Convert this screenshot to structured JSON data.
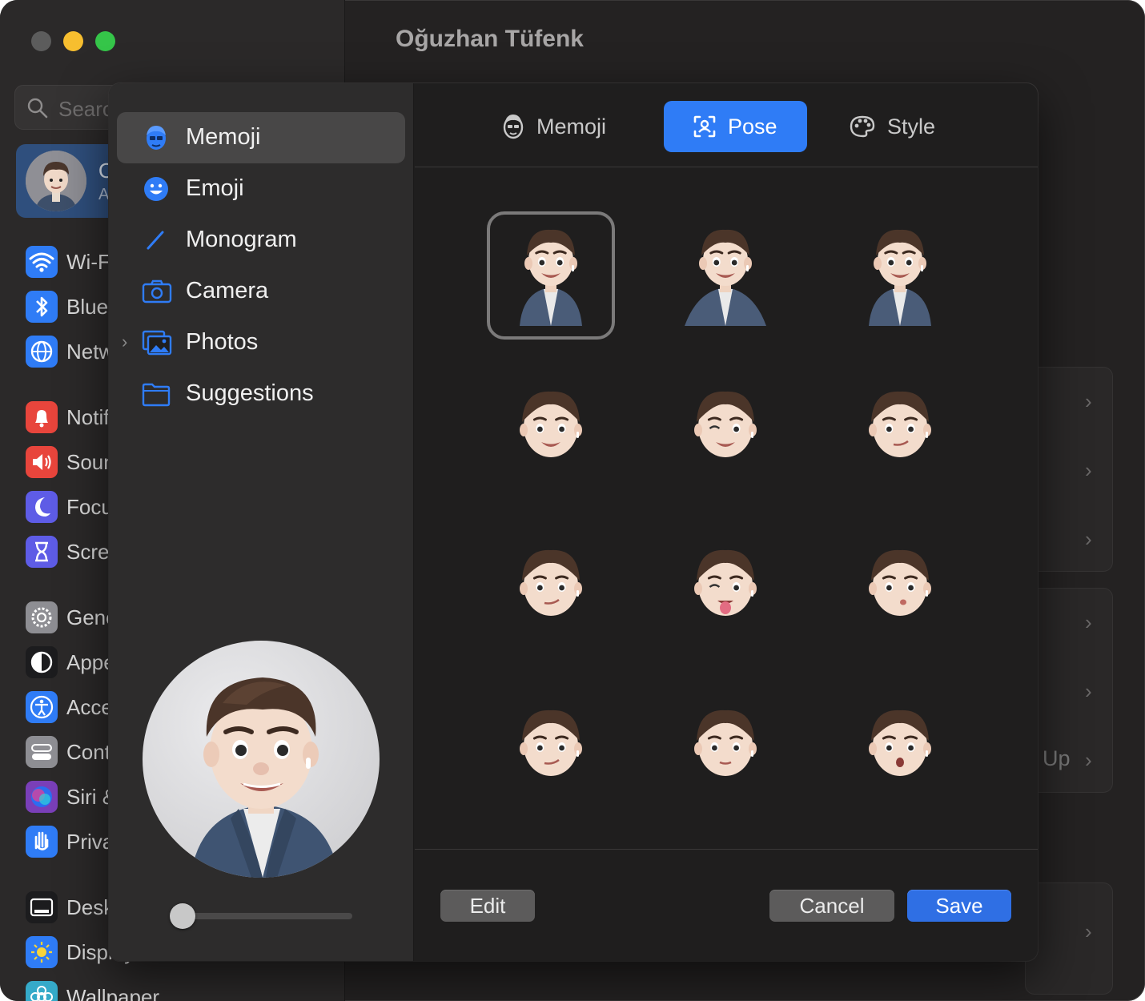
{
  "window": {
    "title": "Oğuzhan Tüfenk"
  },
  "sidebar": {
    "search_placeholder": "Search",
    "account": {
      "name": "O",
      "subtitle": "A"
    },
    "items": [
      {
        "label": "Wi-Fi",
        "icon": "wifi-icon",
        "color": "#2f7cf6"
      },
      {
        "label": "Bluetooth",
        "icon": "bluetooth-icon",
        "color": "#2f7cf6"
      },
      {
        "label": "Network",
        "icon": "globe-icon",
        "color": "#2f7cf6"
      },
      {
        "label": "Notifications",
        "icon": "bell-icon",
        "color": "#e8453c"
      },
      {
        "label": "Sound",
        "icon": "speaker-icon",
        "color": "#e8453c"
      },
      {
        "label": "Focus",
        "icon": "moon-icon",
        "color": "#5e5ce6"
      },
      {
        "label": "Screen Time",
        "icon": "hourglass-icon",
        "color": "#5e5ce6"
      },
      {
        "label": "General",
        "icon": "gear-icon",
        "color": "#8e8e93"
      },
      {
        "label": "Appearance",
        "icon": "appearance-icon",
        "color": "#1c1c1e"
      },
      {
        "label": "Accessibility",
        "icon": "accessibility-icon",
        "color": "#2f7cf6"
      },
      {
        "label": "Control Center",
        "icon": "toggles-icon",
        "color": "#8e8e93"
      },
      {
        "label": "Siri & Spotlight",
        "icon": "siri-icon",
        "color": "#7a3fb8"
      },
      {
        "label": "Privacy & Security",
        "icon": "hand-icon",
        "color": "#2f7cf6"
      },
      {
        "label": "Desktop & Dock",
        "icon": "dock-icon",
        "color": "#1c1c1e"
      },
      {
        "label": "Displays",
        "icon": "sun-icon",
        "color": "#2f7cf6"
      },
      {
        "label": "Wallpaper",
        "icon": "flower-icon",
        "color": "#35aac9"
      }
    ]
  },
  "background": {
    "up_label": "Up"
  },
  "dialog": {
    "sources": [
      {
        "label": "Memoji",
        "icon": "memoji-icon",
        "selected": true
      },
      {
        "label": "Emoji",
        "icon": "smiley-icon",
        "selected": false
      },
      {
        "label": "Monogram",
        "icon": "pencil-icon",
        "selected": false
      },
      {
        "label": "Camera",
        "icon": "camera-icon",
        "selected": false
      },
      {
        "label": "Photos",
        "icon": "photos-icon",
        "selected": false
      },
      {
        "label": "Suggestions",
        "icon": "folder-icon",
        "selected": false
      }
    ],
    "tabs": [
      {
        "label": "Memoji",
        "icon": "memoji-face-icon",
        "active": false
      },
      {
        "label": "Pose",
        "icon": "pose-icon",
        "active": true
      },
      {
        "label": "Style",
        "icon": "palette-icon",
        "active": false
      }
    ],
    "poses": [
      {
        "kind": "bust",
        "expression": "smile",
        "selected": true
      },
      {
        "kind": "bust",
        "expression": "arms-out",
        "selected": false
      },
      {
        "kind": "bust",
        "expression": "grin",
        "selected": false
      },
      {
        "kind": "head",
        "expression": "smile",
        "selected": false
      },
      {
        "kind": "head",
        "expression": "wink-smile",
        "selected": false
      },
      {
        "kind": "head",
        "expression": "smirk",
        "selected": false
      },
      {
        "kind": "head",
        "expression": "side-smirk",
        "selected": false
      },
      {
        "kind": "head",
        "expression": "wink-tongue",
        "selected": false
      },
      {
        "kind": "head",
        "expression": "kiss",
        "selected": false
      },
      {
        "kind": "head",
        "expression": "smirk",
        "selected": false
      },
      {
        "kind": "head",
        "expression": "neutral",
        "selected": false
      },
      {
        "kind": "head",
        "expression": "surprised",
        "selected": false
      }
    ],
    "zoom": 0.0,
    "buttons": {
      "edit": "Edit",
      "cancel": "Cancel",
      "save": "Save"
    }
  }
}
